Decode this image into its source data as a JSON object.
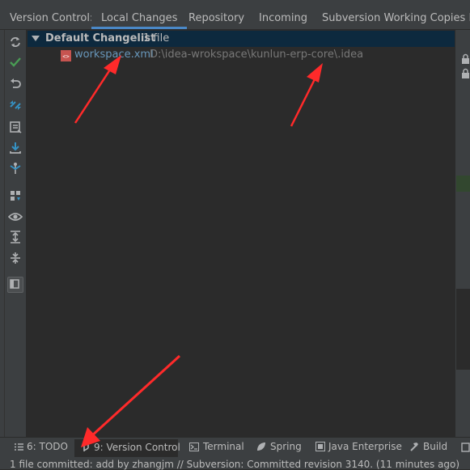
{
  "header": {
    "label": "Version Control:",
    "tabs": [
      {
        "label": "Local Changes",
        "active": true
      },
      {
        "label": "Repository",
        "active": false
      },
      {
        "label": "Incoming",
        "active": false
      },
      {
        "label": "Subversion Working Copies Info",
        "active": false
      }
    ]
  },
  "changelist": {
    "name": "Default Changelist",
    "count": "1 file"
  },
  "file": {
    "name": "workspace.xml",
    "path": "D:\\idea-wrokspace\\kunlun-erp-core\\.idea"
  },
  "toolwindows": [
    {
      "label": "6: TODO",
      "icon": "list-icon"
    },
    {
      "label": "9: Version Control",
      "icon": "vcs-icon",
      "active": true
    },
    {
      "label": "Terminal",
      "icon": "terminal-icon"
    },
    {
      "label": "Spring",
      "icon": "spring-icon"
    },
    {
      "label": "Java Enterprise",
      "icon": "java-enterprise-icon"
    },
    {
      "label": "Build",
      "icon": "hammer-icon"
    }
  ],
  "status": {
    "text": "1 file committed: add by zhangjm // Subversion: Committed revision 3140. (11 minutes ago)"
  },
  "colors": {
    "accent": "#4a88c7",
    "selection": "#0d293e",
    "file_blue": "#6897bb",
    "arrow_red": "#ff2a2a",
    "check_green": "#499c54"
  }
}
